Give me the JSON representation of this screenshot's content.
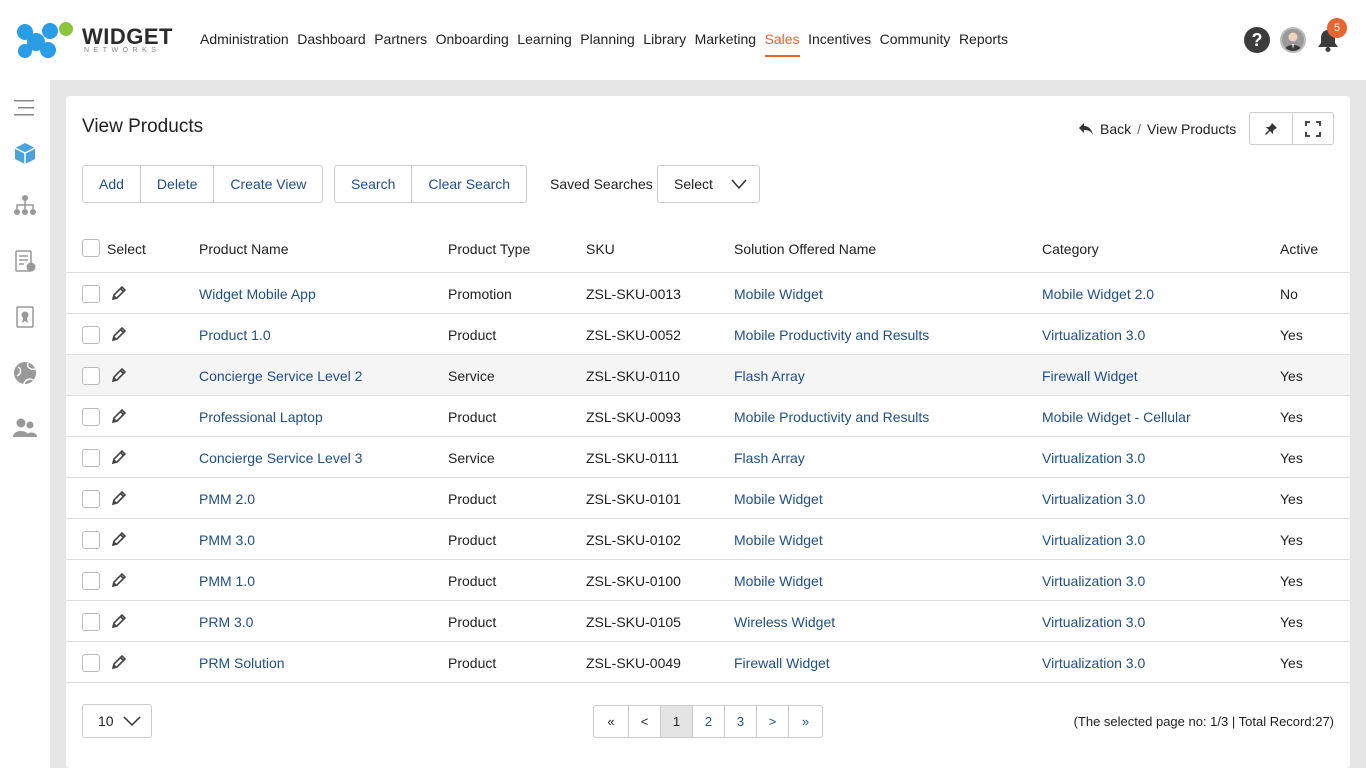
{
  "brand": {
    "name": "WIDGET",
    "sub": "NETWORKS"
  },
  "nav": {
    "items": [
      "Administration",
      "Dashboard",
      "Partners",
      "Onboarding",
      "Learning",
      "Planning",
      "Library",
      "Marketing",
      "Sales",
      "Incentives",
      "Community",
      "Reports"
    ],
    "active": "Sales"
  },
  "header": {
    "help": "?",
    "notifications": "5"
  },
  "page": {
    "title": "View Products",
    "back_label": "Back",
    "breadcrumb_sep": "/",
    "breadcrumb_current": "View Products"
  },
  "toolbar": {
    "add": "Add",
    "delete": "Delete",
    "create_view": "Create View",
    "search": "Search",
    "clear_search": "Clear Search",
    "saved_searches_label": "Saved Searches",
    "saved_searches_value": "Select"
  },
  "table": {
    "columns": {
      "select": "Select",
      "name": "Product Name",
      "type": "Product Type",
      "sku": "SKU",
      "solution": "Solution Offered Name",
      "category": "Category",
      "active": "Active"
    },
    "rows": [
      {
        "name": "Widget Mobile App",
        "type": "Promotion",
        "sku": "ZSL-SKU-0013",
        "solution": "Mobile Widget",
        "category": "Mobile Widget 2.0",
        "active": "No"
      },
      {
        "name": "Product 1.0",
        "type": "Product",
        "sku": "ZSL-SKU-0052",
        "solution": "Mobile Productivity and Results",
        "category": "Virtualization 3.0",
        "active": "Yes"
      },
      {
        "name": "Concierge Service Level 2",
        "type": "Service",
        "sku": "ZSL-SKU-0110",
        "solution": "Flash Array",
        "category": "Firewall Widget",
        "active": "Yes"
      },
      {
        "name": "Professional Laptop",
        "type": "Product",
        "sku": "ZSL-SKU-0093",
        "solution": "Mobile Productivity and Results",
        "category": "Mobile Widget - Cellular",
        "active": "Yes"
      },
      {
        "name": "Concierge Service Level 3",
        "type": "Service",
        "sku": "ZSL-SKU-0111",
        "solution": "Flash Array",
        "category": "Virtualization 3.0",
        "active": "Yes"
      },
      {
        "name": "PMM 2.0",
        "type": "Product",
        "sku": "ZSL-SKU-0101",
        "solution": "Mobile Widget",
        "category": "Virtualization 3.0",
        "active": "Yes"
      },
      {
        "name": "PMM 3.0",
        "type": "Product",
        "sku": "ZSL-SKU-0102",
        "solution": "Mobile Widget",
        "category": "Virtualization 3.0",
        "active": "Yes"
      },
      {
        "name": "PMM 1.0",
        "type": "Product",
        "sku": "ZSL-SKU-0100",
        "solution": "Mobile Widget",
        "category": "Virtualization 3.0",
        "active": "Yes"
      },
      {
        "name": "PRM 3.0",
        "type": "Product",
        "sku": "ZSL-SKU-0105",
        "solution": "Wireless Widget",
        "category": "Virtualization 3.0",
        "active": "Yes"
      },
      {
        "name": "PRM Solution",
        "type": "Product",
        "sku": "ZSL-SKU-0049",
        "solution": "Firewall Widget",
        "category": "Virtualization 3.0",
        "active": "Yes"
      }
    ]
  },
  "footer": {
    "page_size": "10",
    "pager": {
      "first": "«",
      "prev": "<",
      "pages": [
        "1",
        "2",
        "3"
      ],
      "current": "1",
      "next": ">",
      "last": "»"
    },
    "info": "(The selected page no: 1/3 | Total Record:27)"
  },
  "colors": {
    "accent": "#e8652f",
    "link": "#1f4f8a",
    "brand_blue": "#2a9de6",
    "brand_green": "#8cc63f"
  },
  "icons": {
    "side": [
      "menu-icon",
      "products-box-icon",
      "org-chart-icon",
      "invoice-icon",
      "certificate-icon",
      "globe-icon",
      "users-icon"
    ]
  }
}
